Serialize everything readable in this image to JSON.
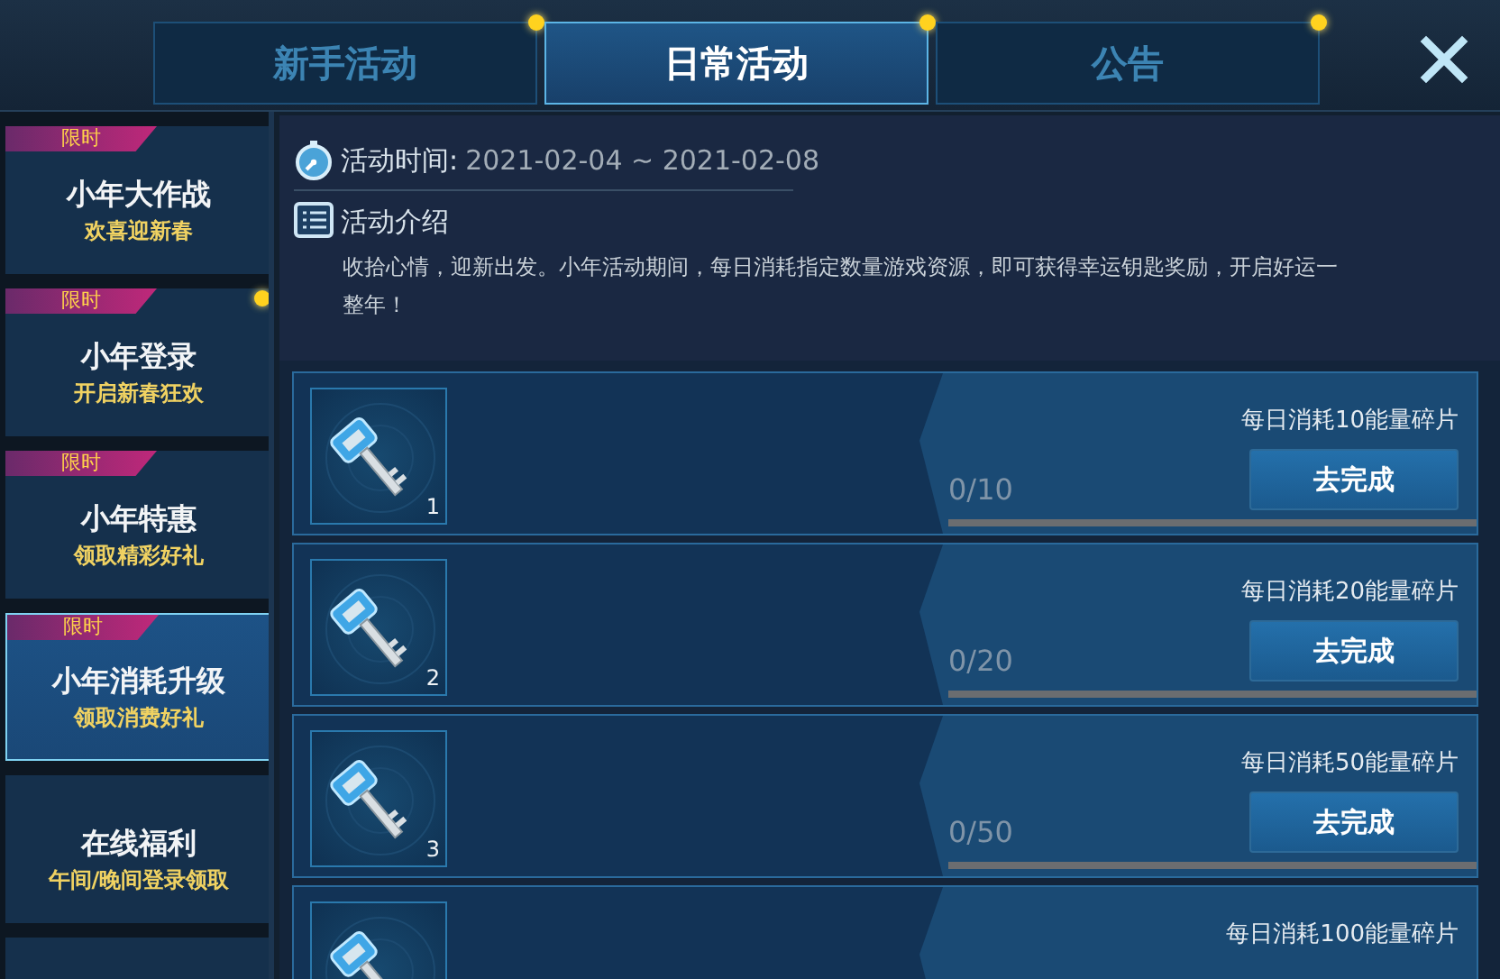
{
  "tabs": [
    {
      "label": "新手活动",
      "selected": false,
      "dot": true
    },
    {
      "label": "日常活动",
      "selected": true,
      "dot": true
    },
    {
      "label": "公告",
      "selected": false,
      "dot": true
    }
  ],
  "sidebar": {
    "items": [
      {
        "badge": "限时",
        "title": "小年大作战",
        "subtitle": "欢喜迎新春",
        "selected": false,
        "dot": false
      },
      {
        "badge": "限时",
        "title": "小年登录",
        "subtitle": "开启新春狂欢",
        "selected": false,
        "dot": true
      },
      {
        "badge": "限时",
        "title": "小年特惠",
        "subtitle": "领取精彩好礼",
        "selected": false,
        "dot": false
      },
      {
        "badge": "限时",
        "title": "小年消耗升级",
        "subtitle": "领取消费好礼",
        "selected": true,
        "dot": false
      },
      {
        "title": "在线福利",
        "subtitle": "午间/晚间登录领取",
        "selected": false,
        "dot": false
      }
    ]
  },
  "info": {
    "time_label": "活动时间:",
    "time_value": "2021-02-04 ~ 2021-02-08",
    "intro_title": "活动介绍",
    "intro_text": "收拾心情，迎新出发。小年活动期间，每日消耗指定数量游戏资源，即可获得幸运钥匙奖励，开启好运一整年！"
  },
  "tasks": [
    {
      "count": "1",
      "title": "每日消耗10能量碎片",
      "progress": "0/10",
      "level": 0,
      "button": "去完成"
    },
    {
      "count": "2",
      "title": "每日消耗20能量碎片",
      "progress": "0/20",
      "level": 0,
      "button": "去完成"
    },
    {
      "count": "3",
      "title": "每日消耗50能量碎片",
      "progress": "0/50",
      "level": 0,
      "button": "去完成"
    },
    {
      "title": "每日消耗100能量碎片"
    }
  ]
}
